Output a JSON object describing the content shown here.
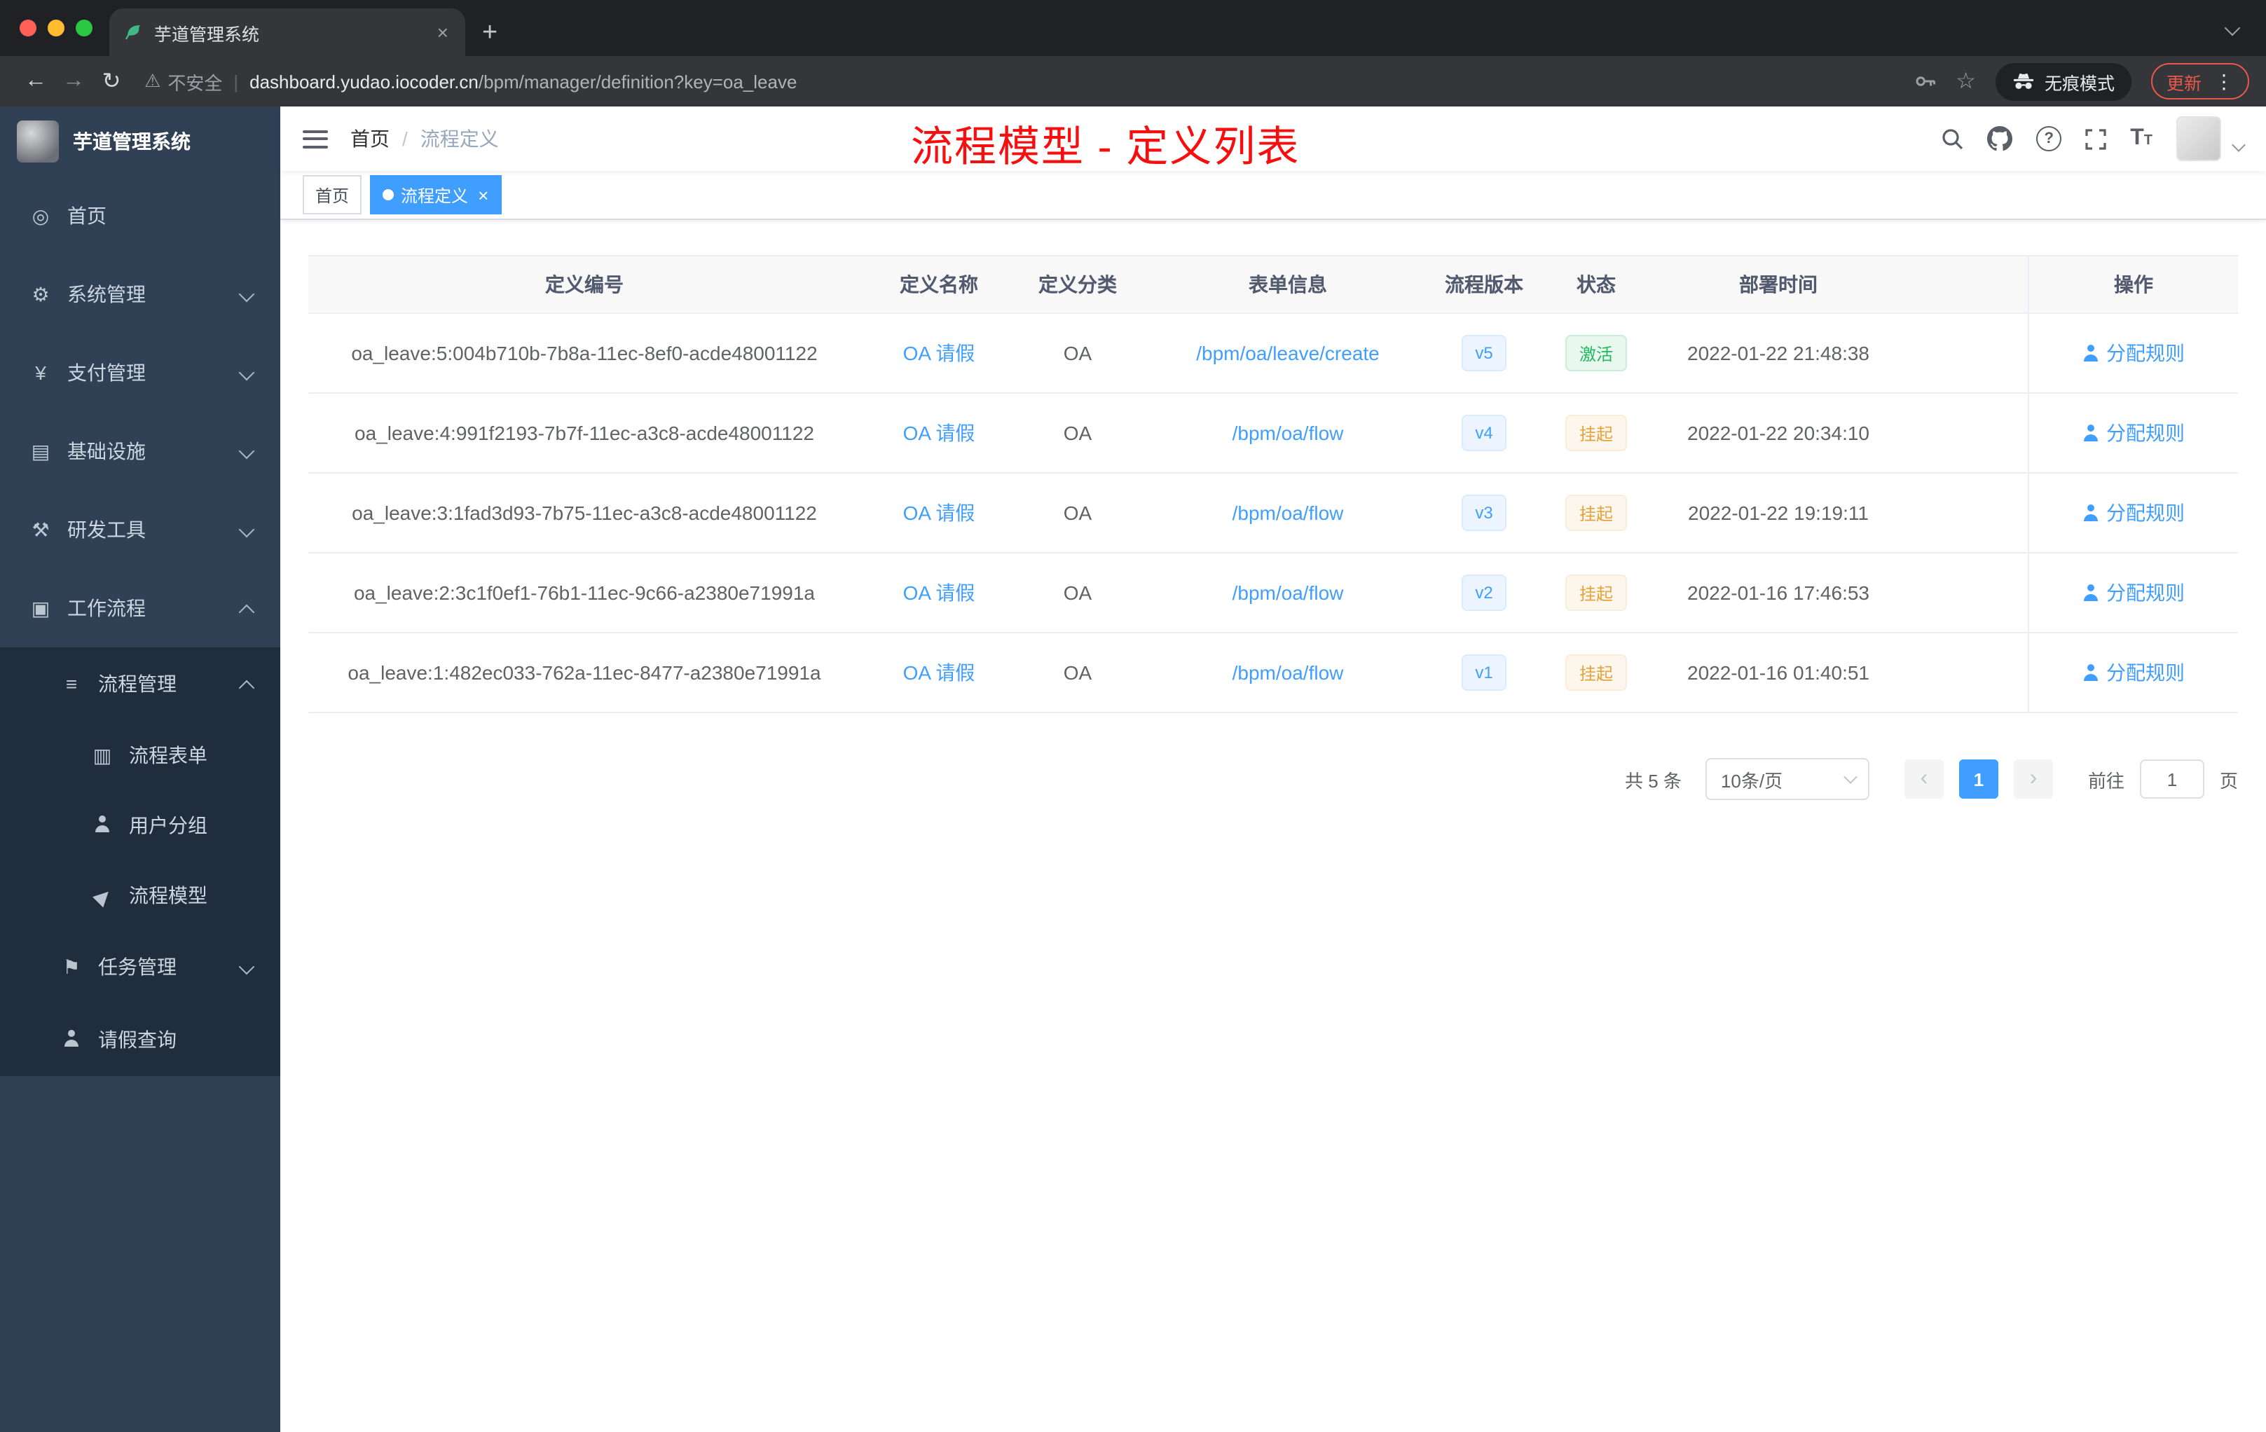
{
  "browser": {
    "tab_title": "芋道管理系统",
    "security_label": "不安全",
    "url_domain": "dashboard.yudao.iocoder.cn",
    "url_path": "/bpm/manager/definition?key=oa_leave",
    "incognito_label": "无痕模式",
    "update_label": "更新"
  },
  "icons": {
    "back": "←",
    "forward": "→",
    "reload": "↻",
    "warning": "⚠",
    "star": "☆",
    "overflow_menu": "⋮",
    "tab_close": "×",
    "new_tab": "+",
    "help": "?",
    "dashboard": "◎",
    "system": "⚙",
    "payment": "¥",
    "infrastructure": "▤",
    "devtools": "⚒",
    "workflow": "▣",
    "process_mgmt": "≡",
    "process_form": "▥",
    "process_model": "▶",
    "task_mgmt": "⚑",
    "breadcrumb_sep": "/",
    "tag_close": "×",
    "font_size_big": "T",
    "font_size_small": "T"
  },
  "sidebar": {
    "logo_title": "芋道管理系统",
    "items": [
      {
        "label": "首页"
      },
      {
        "label": "系统管理"
      },
      {
        "label": "支付管理"
      },
      {
        "label": "基础设施"
      },
      {
        "label": "研发工具"
      },
      {
        "label": "工作流程"
      },
      {
        "label": "流程管理"
      },
      {
        "label": "流程表单"
      },
      {
        "label": "用户分组"
      },
      {
        "label": "流程模型"
      },
      {
        "label": "任务管理"
      },
      {
        "label": "请假查询"
      }
    ]
  },
  "header": {
    "breadcrumb_home": "首页",
    "breadcrumb_current": "流程定义",
    "annotation": "流程模型 - 定义列表"
  },
  "tags": {
    "home": "首页",
    "current": "流程定义"
  },
  "table": {
    "columns": [
      "定义编号",
      "定义名称",
      "定义分类",
      "表单信息",
      "流程版本",
      "状态",
      "部署时间",
      "操作"
    ],
    "rows": [
      {
        "id": "oa_leave:5:004b710b-7b8a-11ec-8ef0-acde48001122",
        "name": "OA 请假",
        "category": "OA",
        "form": "/bpm/oa/leave/create",
        "version": "v5",
        "status": "激活",
        "status_type": "success",
        "time": "2022-01-22 21:48:38",
        "action": "分配规则"
      },
      {
        "id": "oa_leave:4:991f2193-7b7f-11ec-a3c8-acde48001122",
        "name": "OA 请假",
        "category": "OA",
        "form": "/bpm/oa/flow",
        "version": "v4",
        "status": "挂起",
        "status_type": "warning",
        "time": "2022-01-22 20:34:10",
        "action": "分配规则"
      },
      {
        "id": "oa_leave:3:1fad3d93-7b75-11ec-a3c8-acde48001122",
        "name": "OA 请假",
        "category": "OA",
        "form": "/bpm/oa/flow",
        "version": "v3",
        "status": "挂起",
        "status_type": "warning",
        "time": "2022-01-22 19:19:11",
        "action": "分配规则"
      },
      {
        "id": "oa_leave:2:3c1f0ef1-76b1-11ec-9c66-a2380e71991a",
        "name": "OA 请假",
        "category": "OA",
        "form": "/bpm/oa/flow",
        "version": "v2",
        "status": "挂起",
        "status_type": "warning",
        "time": "2022-01-16 17:46:53",
        "action": "分配规则"
      },
      {
        "id": "oa_leave:1:482ec033-762a-11ec-8477-a2380e71991a",
        "name": "OA 请假",
        "category": "OA",
        "form": "/bpm/oa/flow",
        "version": "v1",
        "status": "挂起",
        "status_type": "warning",
        "time": "2022-01-16 01:40:51",
        "action": "分配规则"
      }
    ]
  },
  "pagination": {
    "total": "共 5 条",
    "page_size": "10条/页",
    "prev": "‹",
    "current": "1",
    "next": "›",
    "goto_label": "前往",
    "goto_value": "1",
    "unit": "页"
  },
  "colors": {
    "accent": "#409eff",
    "annotation_red": "#f70e0e",
    "success_green": "#23b85e",
    "warning_orange": "#e6a23c",
    "update_red": "#e9594a",
    "sidebar_bg": "#304156",
    "submenu_bg": "#1f2d3d"
  }
}
